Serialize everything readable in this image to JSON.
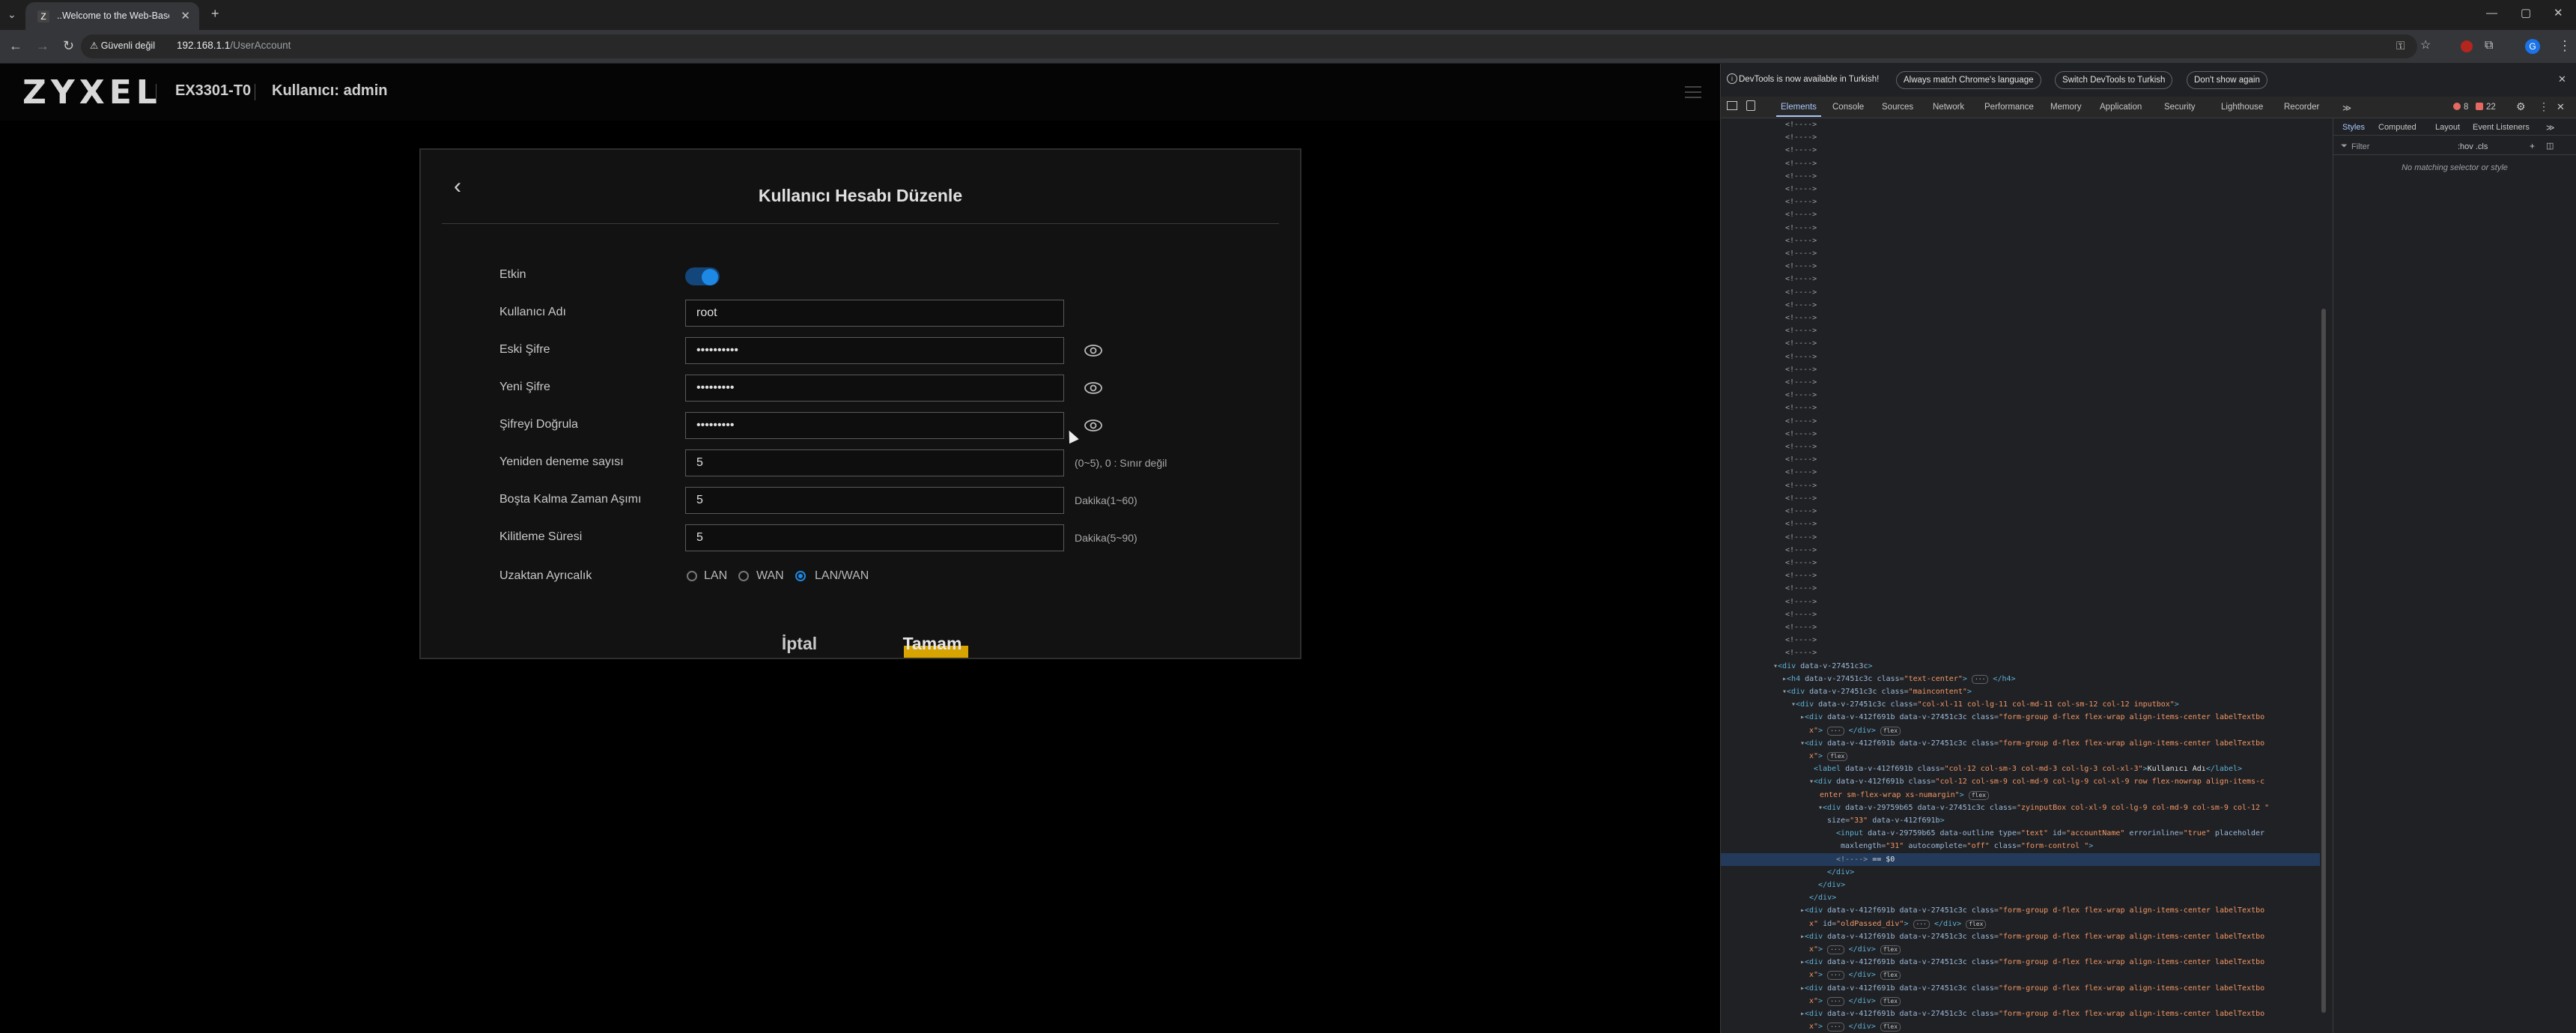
{
  "browser": {
    "tab_title": "..Welcome to the Web-Based C",
    "tab_favicon": "Z",
    "security_chip": "Güvenli değil",
    "url_host": "192.168.1.1",
    "url_path": "/UserAccount"
  },
  "header": {
    "logo": "ZYXEL",
    "model": "EX3301-T0",
    "user_label": "Kullanıcı: admin"
  },
  "form": {
    "title": "Kullanıcı Hesabı Düzenle",
    "enabled_label": "Etkin",
    "enabled": true,
    "username_label": "Kullanıcı Adı",
    "username_value": "root",
    "old_password_label": "Eski Şifre",
    "old_password_value": "••••••••••",
    "new_password_label": "Yeni Şifre",
    "new_password_value": "•••••••••",
    "confirm_password_label": "Şifreyi Doğrula",
    "confirm_password_value": "•••••••••",
    "retry_label": "Yeniden deneme sayısı",
    "retry_value": "5",
    "retry_hint": "(0~5), 0 : Sınır değil",
    "idle_label": "Boşta Kalma Zaman Aşımı",
    "idle_value": "5",
    "idle_hint": "Dakika(1~60)",
    "lockout_label": "Kilitleme Süresi",
    "lockout_value": "5",
    "lockout_hint": "Dakika(5~90)",
    "remote_label": "Uzaktan Ayrıcalık",
    "remote_options": [
      "LAN",
      "WAN",
      "LAN/WAN"
    ],
    "remote_selected": "LAN/WAN",
    "cancel_label": "İptal",
    "ok_label": "Tamam"
  },
  "devtools": {
    "info_text": "DevTools is now available in Turkish!",
    "info_btn_match": "Always match Chrome's language",
    "info_btn_switch": "Switch DevTools to Turkish",
    "info_btn_dismiss": "Don't show again",
    "tabs": [
      "Elements",
      "Console",
      "Sources",
      "Network",
      "Performance",
      "Memory",
      "Application",
      "Security",
      "Lighthouse",
      "Recorder"
    ],
    "more_tabs": "≫",
    "error_count": "8",
    "warning_count": "22",
    "styles_tabs": [
      "Styles",
      "Computed",
      "Layout",
      "Event Listeners"
    ],
    "filter_placeholder": "Filter",
    "hov_cls": ":hov .cls",
    "no_match": "No matching selector or style",
    "comment_text": "<!---->",
    "dom_lines": [
      {
        "indent": 70,
        "html": "▾<span class='tg'>&lt;div</span> <span class='an'>data-v-27451c3c</span><span class='tg'>&gt;</span>"
      },
      {
        "indent": 82,
        "html": "▸<span class='tg'>&lt;h4</span> <span class='an'>data-v-27451c3c class</span>=<span class='av'>\"text-center\"</span><span class='tg'>&gt;</span> <span class='badge'>···</span> <span class='tg'>&lt;/h4&gt;</span>"
      },
      {
        "indent": 82,
        "html": "▾<span class='tg'>&lt;div</span> <span class='an'>data-v-27451c3c class</span>=<span class='av'>\"maincontent\"</span><span class='tg'>&gt;</span>"
      },
      {
        "indent": 94,
        "html": "▾<span class='tg'>&lt;div</span> <span class='an'>data-v-27451c3c class</span>=<span class='av'>\"col-xl-11 col-lg-11 col-md-11 col-sm-12 col-12 inputbox\"</span><span class='tg'>&gt;</span>"
      },
      {
        "indent": 106,
        "html": "▸<span class='tg'>&lt;div</span> <span class='an'>data-v-412f691b data-v-27451c3c class</span>=<span class='av'>\"form-group d-flex flex-wrap align-items-center labelTextbo</span>"
      },
      {
        "indent": 118,
        "html": "<span class='av'>x\"</span><span class='tg'>&gt;</span> <span class='badge'>···</span> <span class='tg'>&lt;/div&gt;</span> <span class='badge'>flex</span>"
      },
      {
        "indent": 106,
        "html": "▾<span class='tg'>&lt;div</span> <span class='an'>data-v-412f691b data-v-27451c3c class</span>=<span class='av'>\"form-group d-flex flex-wrap align-items-center labelTextbo</span>"
      },
      {
        "indent": 118,
        "html": "<span class='av'>x\"</span><span class='tg'>&gt;</span> <span class='badge'>flex</span>"
      },
      {
        "indent": 124,
        "html": "<span class='tg'>&lt;label</span> <span class='an'>data-v-412f691b class</span>=<span class='av'>\"col-12 col-sm-3 col-md-3 col-lg-3 col-xl-3\"</span><span class='tg'>&gt;</span><span class='tx'>Kullanıcı Adı</span><span class='tg'>&lt;/label&gt;</span>"
      },
      {
        "indent": 118,
        "html": "▾<span class='tg'>&lt;div</span> <span class='an'>data-v-412f691b class</span>=<span class='av'>\"col-12 col-sm-9 col-md-9 col-lg-9 col-xl-9 row flex-nowrap align-items-c</span>"
      },
      {
        "indent": 132,
        "html": "<span class='av'>enter sm-flex-wrap xs-numargin\"</span><span class='tg'>&gt;</span> <span class='badge'>flex</span>"
      },
      {
        "indent": 130,
        "html": "▾<span class='tg'>&lt;div</span> <span class='an'>data-v-29759b65 data-v-27451c3c class</span>=<span class='av'>\"zyinputBox col-xl-9 col-lg-9 col-md-9 col-sm-9 col-12 \"</span>"
      },
      {
        "indent": 142,
        "html": "<span class='an'>size</span>=<span class='av'>\"33\"</span> <span class='an'>data-v-412f691b</span><span class='tg'>&gt;</span>"
      },
      {
        "indent": 154,
        "html": "<span class='tg'>&lt;input</span> <span class='an'>data-v-29759b65 data-outline type</span>=<span class='av'>\"text\"</span> <span class='an'>id</span>=<span class='av'>\"accountName\"</span> <span class='an'>errorinline</span>=<span class='av'>\"true\"</span> <span class='an'>placeholder</span>"
      },
      {
        "indent": 160,
        "html": "<span class='an'>maxlength</span>=<span class='av'>\"31\"</span> <span class='an'>autocomplete</span>=<span class='av'>\"off\"</span> <span class='an'>class</span>=<span class='av'>\"form-control \"</span><span class='tg'>&gt;</span>"
      },
      {
        "indent": 154,
        "html": "<span>&lt;!----&gt;</span> <span class='tx'>== $0</span>",
        "selected": true
      },
      {
        "indent": 142,
        "html": "<span class='tg'>&lt;/div&gt;</span>"
      },
      {
        "indent": 130,
        "html": "<span class='tg'>&lt;/div&gt;</span>"
      },
      {
        "indent": 118,
        "html": "<span class='tg'>&lt;/div&gt;</span>"
      },
      {
        "indent": 106,
        "html": "▸<span class='tg'>&lt;div</span> <span class='an'>data-v-412f691b data-v-27451c3c class</span>=<span class='av'>\"form-group d-flex flex-wrap align-items-center labelTextbo</span>"
      },
      {
        "indent": 118,
        "html": "<span class='av'>x\"</span> <span class='an'>id</span>=<span class='av'>\"oldPassed_div\"</span><span class='tg'>&gt;</span> <span class='badge'>···</span> <span class='tg'>&lt;/div&gt;</span> <span class='badge'>flex</span>"
      },
      {
        "indent": 106,
        "html": "▸<span class='tg'>&lt;div</span> <span class='an'>data-v-412f691b data-v-27451c3c class</span>=<span class='av'>\"form-group d-flex flex-wrap align-items-center labelTextbo</span>"
      },
      {
        "indent": 118,
        "html": "<span class='av'>x\"</span><span class='tg'>&gt;</span> <span class='badge'>···</span> <span class='tg'>&lt;/div&gt;</span> <span class='badge'>flex</span>"
      },
      {
        "indent": 106,
        "html": "▸<span class='tg'>&lt;div</span> <span class='an'>data-v-412f691b data-v-27451c3c class</span>=<span class='av'>\"form-group d-flex flex-wrap align-items-center labelTextbo</span>"
      },
      {
        "indent": 118,
        "html": "<span class='av'>x\"</span><span class='tg'>&gt;</span> <span class='badge'>···</span> <span class='tg'>&lt;/div&gt;</span> <span class='badge'>flex</span>"
      },
      {
        "indent": 106,
        "html": "▸<span class='tg'>&lt;div</span> <span class='an'>data-v-412f691b data-v-27451c3c class</span>=<span class='av'>\"form-group d-flex flex-wrap align-items-center labelTextbo</span>"
      },
      {
        "indent": 118,
        "html": "<span class='av'>x\"</span><span class='tg'>&gt;</span> <span class='badge'>···</span> <span class='tg'>&lt;/div&gt;</span> <span class='badge'>flex</span>"
      },
      {
        "indent": 106,
        "html": "▸<span class='tg'>&lt;div</span> <span class='an'>data-v-412f691b data-v-27451c3c class</span>=<span class='av'>\"form-group d-flex flex-wrap align-items-center labelTextbo</span>"
      },
      {
        "indent": 118,
        "html": "<span class='av'>x\"</span><span class='tg'>&gt;</span> <span class='badge'>···</span> <span class='tg'>&lt;/div&gt;</span> <span class='badge'>flex</span>"
      }
    ]
  },
  "colors": {
    "accent_blue": "#1e88e5",
    "ok_highlight": "#d8a400",
    "page_bg": "#000000",
    "card_bg": "#121212"
  }
}
